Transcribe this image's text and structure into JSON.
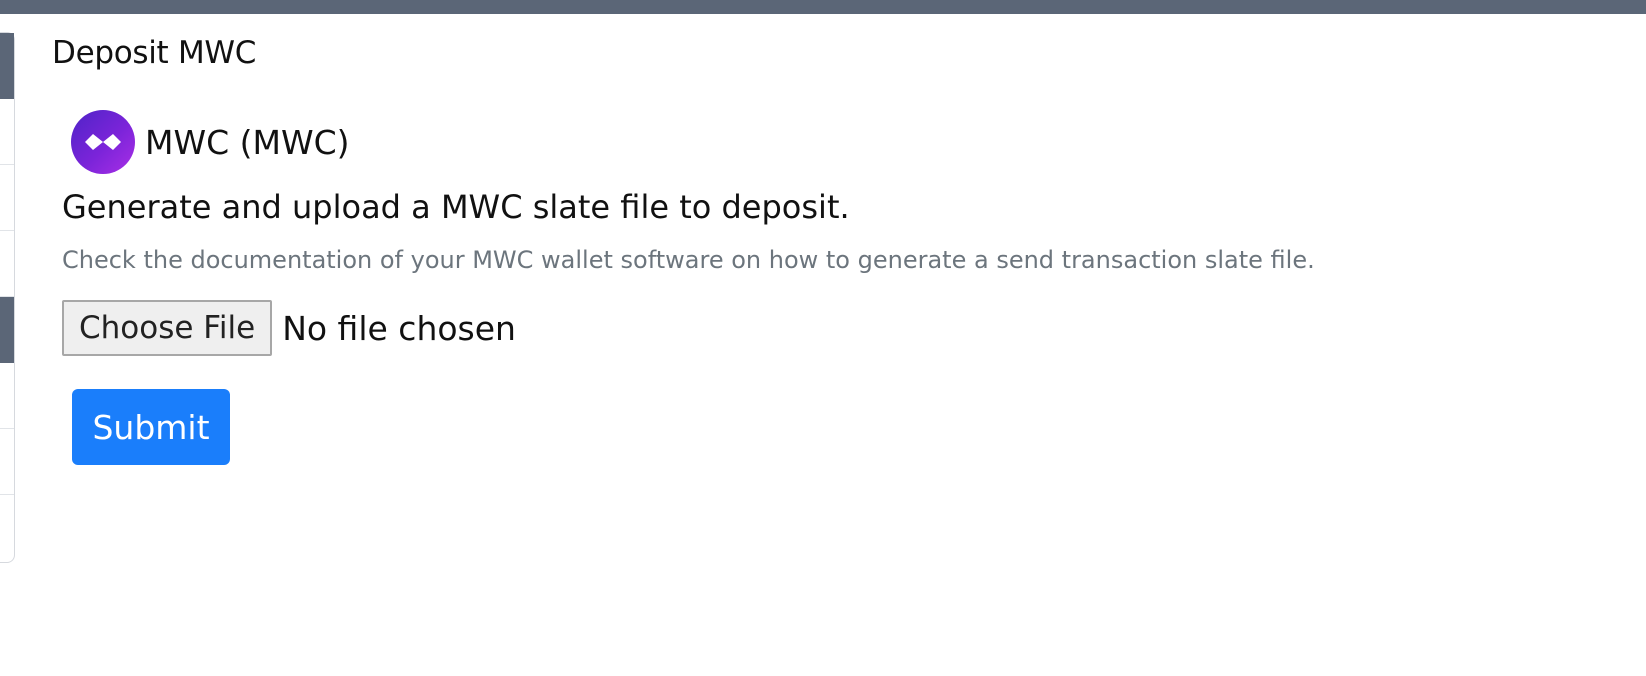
{
  "page": {
    "title": "Deposit MWC"
  },
  "coin": {
    "name": "MWC (MWC)",
    "icon": "mwc-logo-icon",
    "logo_colors": [
      "#4e23c7",
      "#a92fe6"
    ]
  },
  "form": {
    "headline": "Generate and upload a MWC slate file to deposit.",
    "help_text": "Check the documentation of your MWC wallet software on how to generate a send transaction slate file.",
    "file_button_label": "Choose File",
    "file_status": "No file chosen",
    "submit_label": "Submit"
  },
  "colors": {
    "topbar": "#5b6677",
    "accent": "#1a7efb",
    "muted_text": "#6c757d"
  }
}
